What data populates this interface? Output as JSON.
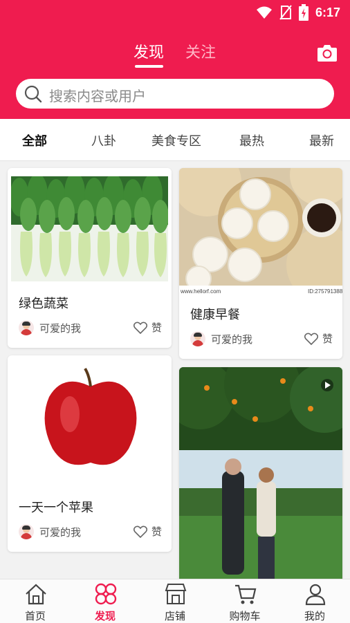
{
  "status_bar": {
    "time": "6:17"
  },
  "top_tabs": [
    {
      "label": "发现"
    },
    {
      "label": "关注"
    }
  ],
  "search": {
    "placeholder": "搜索内容或用户"
  },
  "categories": [
    {
      "label": "全部"
    },
    {
      "label": "八卦"
    },
    {
      "label": "美食专区"
    },
    {
      "label": "最热"
    },
    {
      "label": "最新"
    }
  ],
  "feed": {
    "cards": [
      {
        "title": "绿色蔬菜",
        "author": "可爱的我",
        "like_label": "赞"
      },
      {
        "title": "健康早餐",
        "author": "可爱的我",
        "like_label": "赞",
        "watermark_left": "www.hellorf.com",
        "watermark_right": "ID:275791388"
      },
      {
        "title": "一天一个苹果",
        "author": "可爱的我",
        "like_label": "赞"
      },
      {
        "title": "",
        "author": "",
        "like_label": ""
      }
    ]
  },
  "bottom_nav": [
    {
      "label": "首页"
    },
    {
      "label": "发现"
    },
    {
      "label": "店铺"
    },
    {
      "label": "购物车"
    },
    {
      "label": "我的"
    }
  ],
  "colors": {
    "brand": "#ef1c4f",
    "inactive_tab": "#ffb6c6"
  },
  "icons": {
    "search": "search-icon",
    "camera": "camera-icon",
    "heart": "heart-icon",
    "video": "play-icon"
  }
}
